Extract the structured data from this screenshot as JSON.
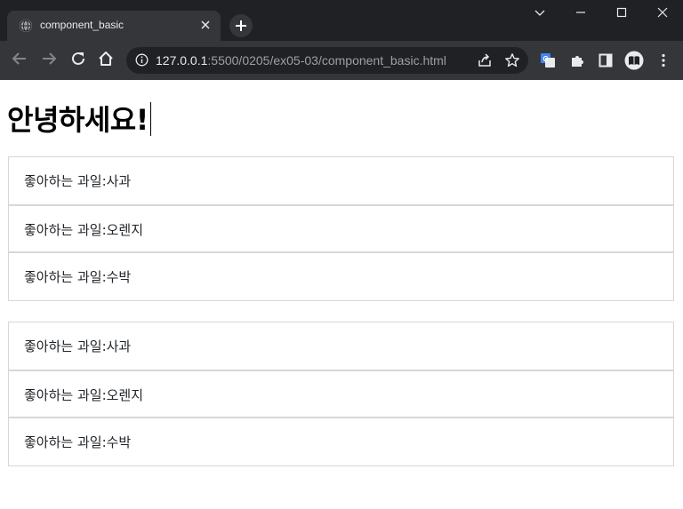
{
  "browser": {
    "tab_title": "component_basic",
    "url_host": "127.0.0.1",
    "url_path": ":5500/0205/ex05-03/component_basic.html"
  },
  "page": {
    "heading": "안녕하세요!",
    "lists": [
      {
        "items": [
          "좋아하는 과일:사과",
          "좋아하는 과일:오렌지",
          "좋아하는 과일:수박"
        ]
      },
      {
        "items": [
          "좋아하는 과일:사과",
          "좋아하는 과일:오렌지",
          "좋아하는 과일:수박"
        ]
      }
    ]
  },
  "icons": {
    "tab": [
      "globe-icon",
      "close-icon",
      "plus-icon"
    ],
    "window": [
      "chevron-down-icon",
      "minimize-icon",
      "maximize-icon",
      "close-icon"
    ],
    "nav": [
      "back-arrow-icon",
      "forward-arrow-icon",
      "reload-icon",
      "home-icon"
    ],
    "omnibox": [
      "info-icon",
      "share-icon",
      "star-icon"
    ],
    "extensions": [
      "translate-icon",
      "puzzle-icon",
      "sidepanel-icon",
      "profile-icon",
      "kebab-menu-icon"
    ]
  }
}
